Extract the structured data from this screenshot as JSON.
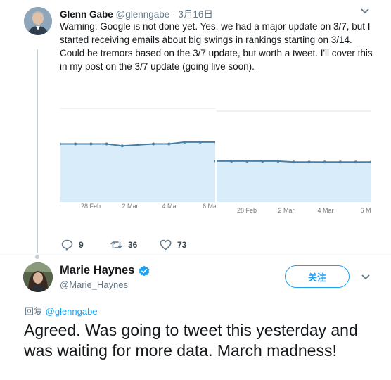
{
  "tweet1": {
    "author_name": "Glenn Gabe",
    "author_handle": "@glenngabe",
    "date": "3月16日",
    "text": "Warning: Google is not done yet. Yes, we had a major update on 3/7, but I started receiving emails about big swings in rankings starting on 3/14. Could be tremors based on the 3/7 update, but worth a tweet. I'll cover this in my post on the 3/7 update (going live soon).",
    "avatar_icon": "profile-photo-icon",
    "actions": {
      "reply_count": "9",
      "retweet_count": "36",
      "like_count": "73"
    }
  },
  "chart_data": [
    {
      "type": "area",
      "x": [
        "28 Feb",
        "2 Mar",
        "4 Mar",
        "6 Ma"
      ],
      "tick_labels": [
        "",
        "28 Feb",
        "2 Mar",
        "4 Mar",
        "6 Ma"
      ],
      "series": [
        {
          "values": [
            0.62,
            0.62,
            0.62,
            0.62,
            0.6,
            0.61,
            0.62,
            0.62,
            0.64,
            0.64,
            0.64
          ]
        }
      ],
      "ylim": [
        0,
        1
      ],
      "grid": true,
      "colors": {
        "line": "#4a7fa5",
        "fill": "#d9ecf9"
      }
    },
    {
      "type": "area",
      "x": [
        "28 Feb",
        "2 Mar",
        "4 Mar",
        "6 M"
      ],
      "tick_labels": [
        "28 Feb",
        "2 Mar",
        "4 Mar",
        "6 M"
      ],
      "series": [
        {
          "values": [
            0.45,
            0.45,
            0.45,
            0.45,
            0.45,
            0.44,
            0.44,
            0.44,
            0.44,
            0.44,
            0.44
          ]
        }
      ],
      "ylim": [
        0,
        1
      ],
      "grid": true,
      "colors": {
        "line": "#4a7fa5",
        "fill": "#d9ecf9"
      }
    }
  ],
  "tweet2": {
    "author_name": "Marie Haynes",
    "author_handle": "@Marie_Haynes",
    "follow_label": "关注",
    "reply_prefix": "回复",
    "reply_mention": "@glenngabe",
    "text": "Agreed. Was going to tweet this yesterday and was waiting for more data. March madness!",
    "verified_icon": "verified-badge-icon"
  },
  "colors": {
    "accent": "#1da1f2",
    "secondary_text": "#657786",
    "thread_line": "#c4cfd6"
  }
}
